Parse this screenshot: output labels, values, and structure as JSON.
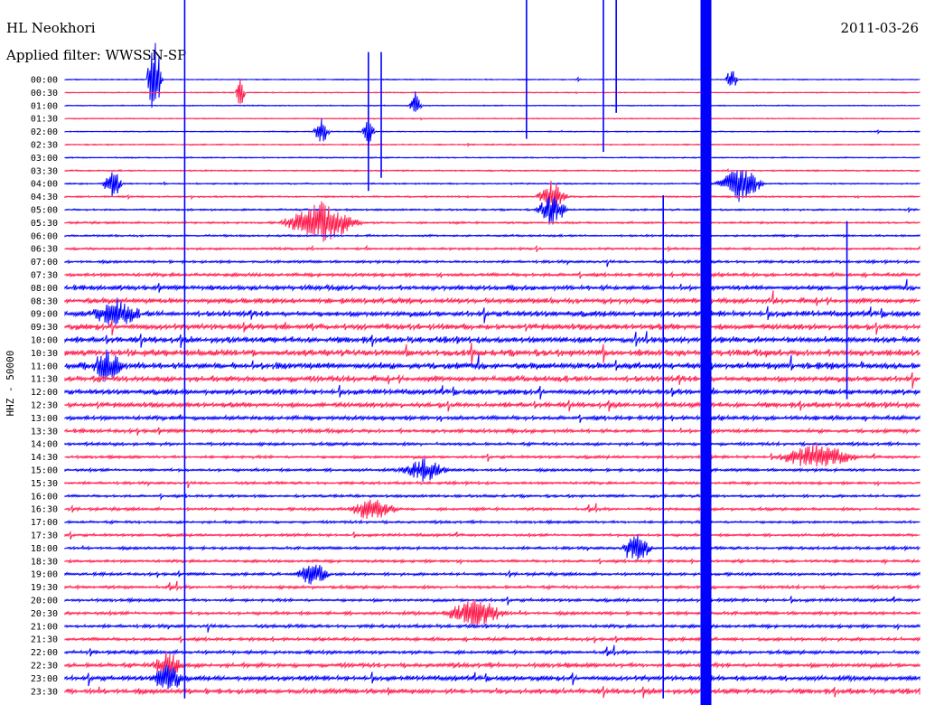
{
  "header": {
    "station": "HL Neokhori",
    "date": "2011-03-26",
    "filter": "Applied filter: WWSSN-SP"
  },
  "chart_data": {
    "type": "line",
    "ylabel": "HHZ - 50000",
    "row_interval_minutes": 30,
    "categories": [
      "00:00",
      "00:30",
      "01:00",
      "01:30",
      "02:00",
      "02:30",
      "03:00",
      "03:30",
      "04:00",
      "04:30",
      "05:00",
      "05:30",
      "06:00",
      "06:30",
      "07:00",
      "07:30",
      "08:00",
      "08:30",
      "09:00",
      "09:30",
      "10:00",
      "10:30",
      "11:00",
      "11:30",
      "12:00",
      "12:30",
      "13:00",
      "13:30",
      "14:00",
      "14:30",
      "15:00",
      "15:30",
      "16:00",
      "16:30",
      "17:00",
      "17:30",
      "18:00",
      "18:30",
      "19:00",
      "19:30",
      "20:00",
      "20:30",
      "21:00",
      "21:30",
      "22:00",
      "22:30",
      "23:00",
      "23:30"
    ],
    "row_colors": [
      "#0000ff",
      "#ff2050"
    ],
    "series": [
      {
        "color": "#0000ff"
      },
      {
        "color": "#ff2050"
      }
    ],
    "activity": [
      0.04,
      0.04,
      0.04,
      0.04,
      0.04,
      0.05,
      0.05,
      0.06,
      0.06,
      0.07,
      0.08,
      0.09,
      0.09,
      0.1,
      0.12,
      0.16,
      0.22,
      0.25,
      0.26,
      0.27,
      0.28,
      0.3,
      0.3,
      0.27,
      0.24,
      0.23,
      0.2,
      0.17,
      0.14,
      0.13,
      0.13,
      0.12,
      0.12,
      0.13,
      0.12,
      0.12,
      0.13,
      0.13,
      0.13,
      0.14,
      0.14,
      0.15,
      0.15,
      0.15,
      0.16,
      0.2,
      0.22,
      0.24
    ],
    "events": [
      {
        "row": 0,
        "x": 0.105,
        "amp": 6.0,
        "dur": 0.01
      },
      {
        "row": 0,
        "x": 0.78,
        "amp": 1.5,
        "dur": 0.008
      },
      {
        "row": 1,
        "x": 0.205,
        "amp": 2.0,
        "dur": 0.006
      },
      {
        "row": 2,
        "x": 0.41,
        "amp": 1.8,
        "dur": 0.008
      },
      {
        "row": 4,
        "x": 0.3,
        "amp": 2.0,
        "dur": 0.01
      },
      {
        "row": 4,
        "x": 0.355,
        "amp": 2.2,
        "dur": 0.008
      },
      {
        "row": 8,
        "x": 0.055,
        "amp": 2.5,
        "dur": 0.012
      },
      {
        "row": 8,
        "x": 0.79,
        "amp": 2.2,
        "dur": 0.03
      },
      {
        "row": 9,
        "x": 0.57,
        "amp": 2.0,
        "dur": 0.02
      },
      {
        "row": 10,
        "x": 0.57,
        "amp": 2.0,
        "dur": 0.02
      },
      {
        "row": 11,
        "x": 0.3,
        "amp": 2.5,
        "dur": 0.05
      },
      {
        "row": 18,
        "x": 0.06,
        "amp": 1.8,
        "dur": 0.03
      },
      {
        "row": 22,
        "x": 0.05,
        "amp": 2.0,
        "dur": 0.02
      },
      {
        "row": 29,
        "x": 0.88,
        "amp": 1.6,
        "dur": 0.05
      },
      {
        "row": 30,
        "x": 0.42,
        "amp": 1.5,
        "dur": 0.03
      },
      {
        "row": 33,
        "x": 0.36,
        "amp": 1.5,
        "dur": 0.03
      },
      {
        "row": 36,
        "x": 0.67,
        "amp": 1.6,
        "dur": 0.02
      },
      {
        "row": 38,
        "x": 0.29,
        "amp": 1.8,
        "dur": 0.02
      },
      {
        "row": 41,
        "x": 0.48,
        "amp": 1.8,
        "dur": 0.04
      },
      {
        "row": 45,
        "x": 0.12,
        "amp": 1.8,
        "dur": 0.02
      },
      {
        "row": 46,
        "x": 0.12,
        "amp": 2.0,
        "dur": 0.02
      }
    ],
    "spikes": [
      {
        "x": 0.14,
        "rows": [
          0,
          47
        ]
      },
      {
        "x": 0.355,
        "rows": [
          4,
          8
        ]
      },
      {
        "x": 0.37,
        "rows": [
          4,
          7
        ]
      },
      {
        "x": 0.54,
        "rows": [
          0,
          4
        ]
      },
      {
        "x": 0.63,
        "rows": [
          0,
          5
        ]
      },
      {
        "x": 0.645,
        "rows": [
          0,
          2
        ]
      },
      {
        "x": 0.7,
        "rows": [
          15,
          47
        ]
      },
      {
        "x": 0.915,
        "rows": [
          17,
          24
        ]
      }
    ],
    "glitch_band": {
      "x": 0.75,
      "rows": [
        0,
        47
      ]
    }
  }
}
